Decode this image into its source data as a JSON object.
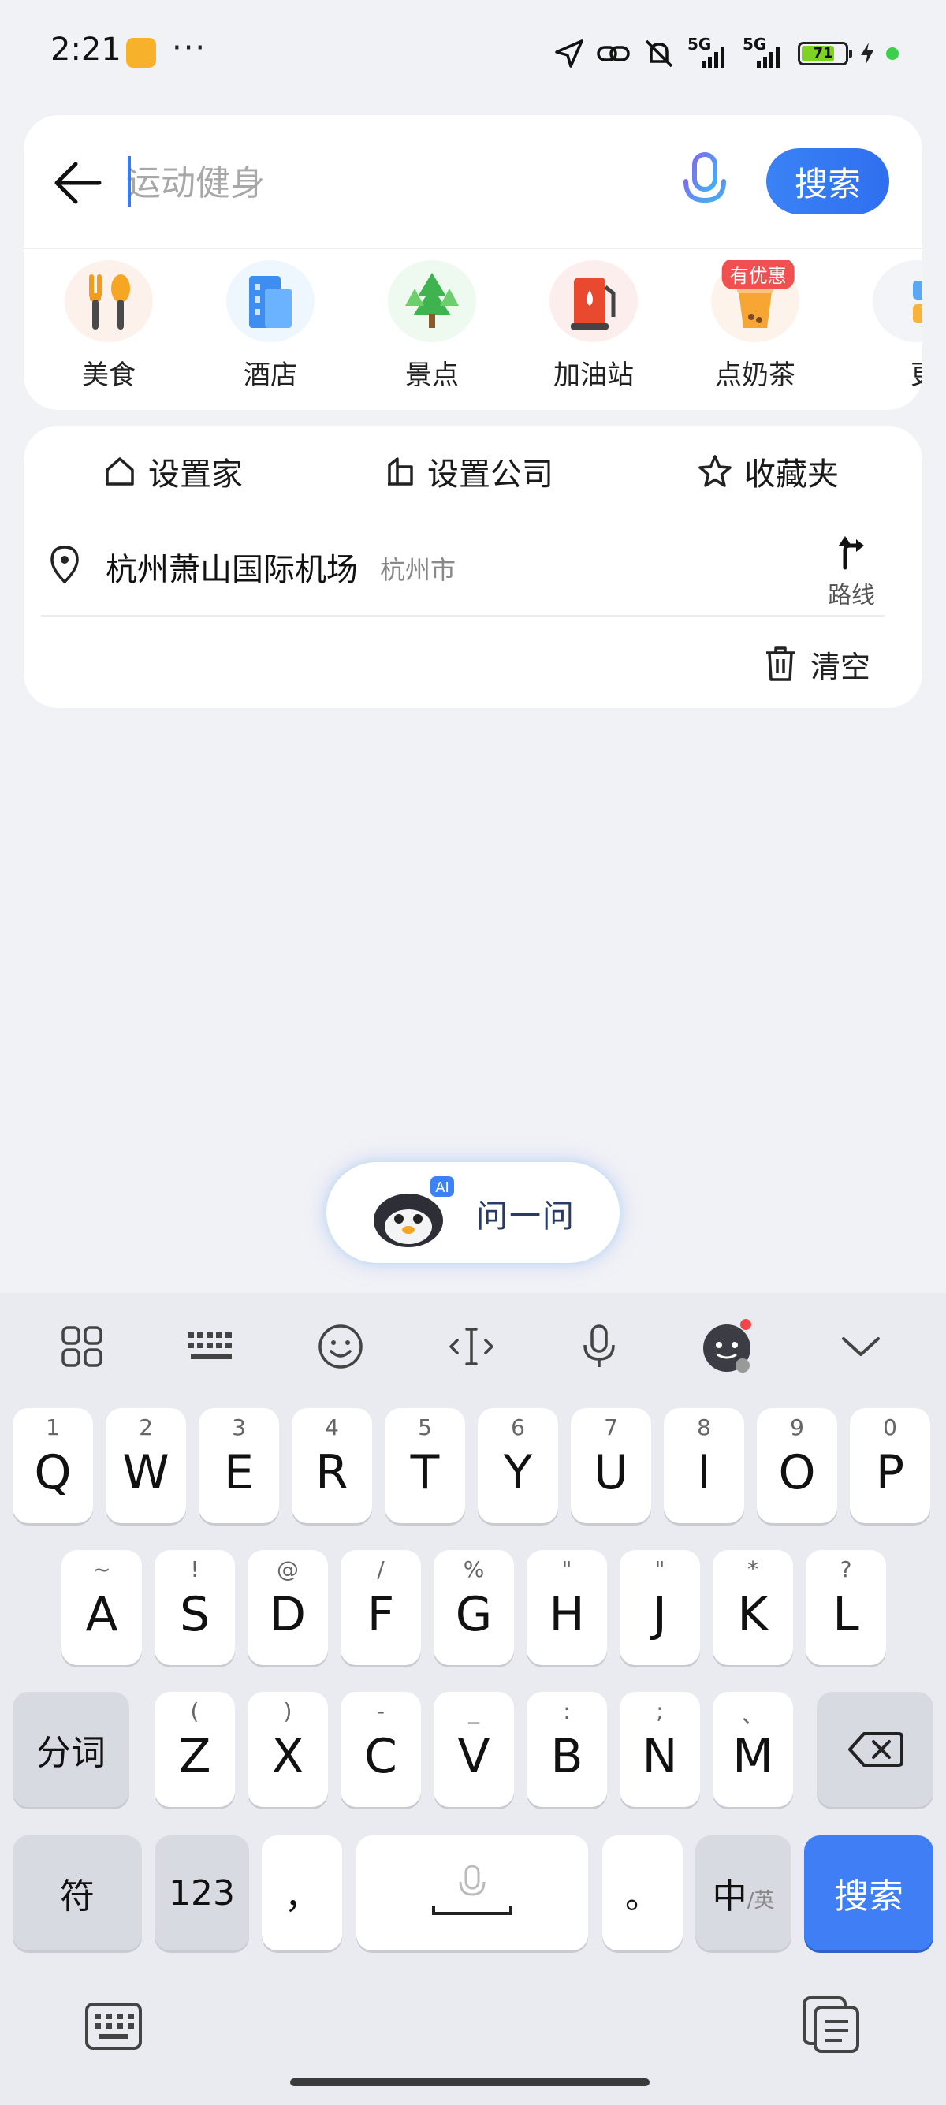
{
  "status_bar": {
    "time": "2:21",
    "more": "···",
    "signal1": "5G",
    "signal2": "5G",
    "battery": "71"
  },
  "search": {
    "placeholder": "运动健身",
    "button": "搜索"
  },
  "categories": [
    {
      "label": "美食",
      "icon": "food-icon"
    },
    {
      "label": "酒店",
      "icon": "hotel-icon"
    },
    {
      "label": "景点",
      "icon": "scenic-icon"
    },
    {
      "label": "加油站",
      "icon": "gas-station-icon"
    },
    {
      "label": "点奶茶",
      "icon": "milk-tea-icon",
      "badge": "有优惠"
    },
    {
      "label": "更",
      "icon": "more-icon"
    }
  ],
  "quick": {
    "home": "设置家",
    "company": "设置公司",
    "favorites": "收藏夹"
  },
  "history": {
    "name": "杭州萧山国际机场",
    "city": "杭州市",
    "route": "路线",
    "clear": "清空"
  },
  "ask": {
    "label": "问一问",
    "badge": "AI"
  },
  "keyboard": {
    "row1": [
      {
        "k": "Q",
        "s": "1"
      },
      {
        "k": "W",
        "s": "2"
      },
      {
        "k": "E",
        "s": "3"
      },
      {
        "k": "R",
        "s": "4"
      },
      {
        "k": "T",
        "s": "5"
      },
      {
        "k": "Y",
        "s": "6"
      },
      {
        "k": "U",
        "s": "7"
      },
      {
        "k": "I",
        "s": "8"
      },
      {
        "k": "O",
        "s": "9"
      },
      {
        "k": "P",
        "s": "0"
      }
    ],
    "row2": [
      {
        "k": "A",
        "s": "~"
      },
      {
        "k": "S",
        "s": "!"
      },
      {
        "k": "D",
        "s": "@"
      },
      {
        "k": "F",
        "s": "/"
      },
      {
        "k": "G",
        "s": "%"
      },
      {
        "k": "H",
        "s": "\""
      },
      {
        "k": "J",
        "s": "\""
      },
      {
        "k": "K",
        "s": "*"
      },
      {
        "k": "L",
        "s": "?"
      }
    ],
    "row3": [
      {
        "k": "Z",
        "s": "("
      },
      {
        "k": "X",
        "s": ")"
      },
      {
        "k": "C",
        "s": "-"
      },
      {
        "k": "V",
        "s": "_"
      },
      {
        "k": "B",
        "s": ":"
      },
      {
        "k": "N",
        "s": ";"
      },
      {
        "k": "M",
        "s": "、"
      }
    ],
    "segment": "分词",
    "symbols": "符",
    "numbers": "123",
    "comma": "，",
    "period": "。",
    "lang_main": "中",
    "lang_sub": "/英",
    "search": "搜索"
  }
}
